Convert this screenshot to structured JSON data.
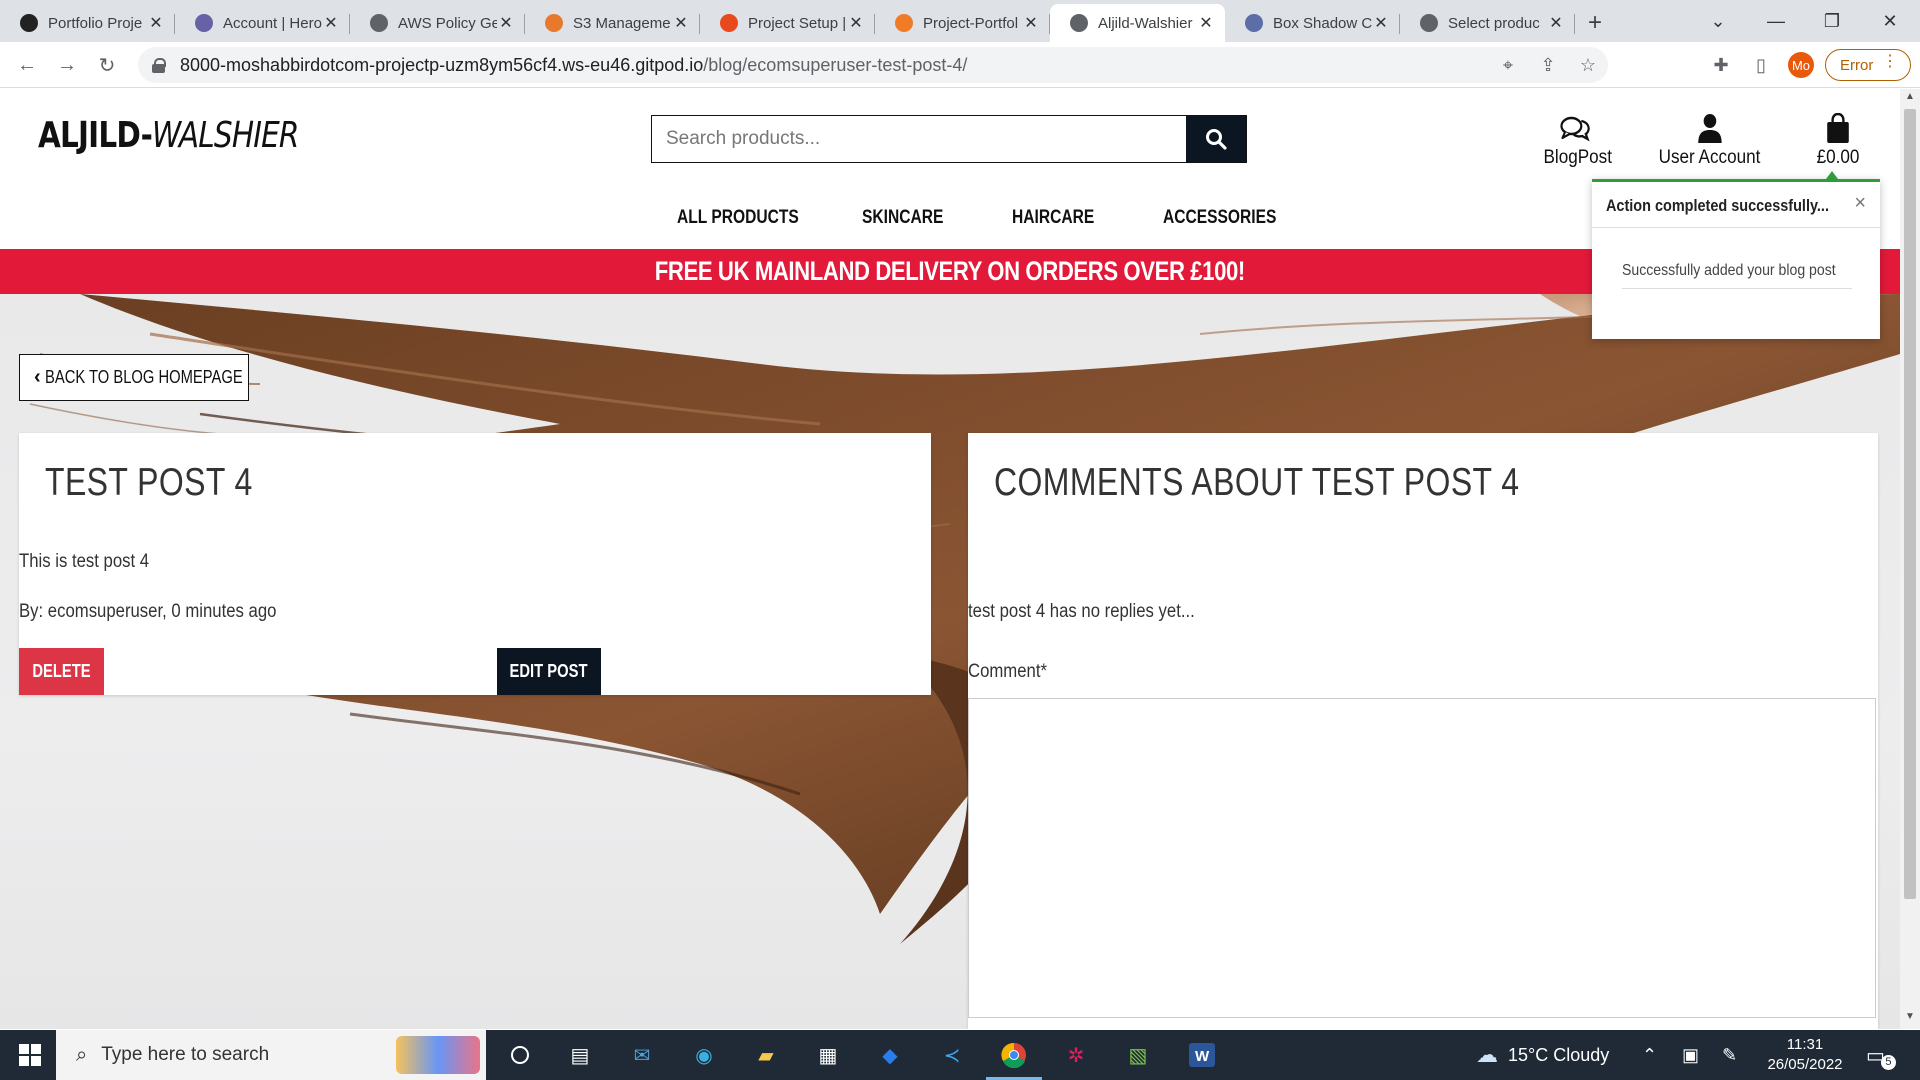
{
  "browser": {
    "tabs": [
      {
        "label": "Portfolio Proje",
        "icon": "github-icon",
        "color": "#222222"
      },
      {
        "label": "Account | Hero",
        "icon": "heroku-icon",
        "color": "#6762a6"
      },
      {
        "label": "AWS Policy Ge",
        "icon": "globe-icon",
        "color": "#5f6368"
      },
      {
        "label": "S3 Manageme",
        "icon": "aws-s3-icon",
        "color": "#e8792c"
      },
      {
        "label": "Project Setup |",
        "icon": "opera-icon",
        "color": "#e8491d"
      },
      {
        "label": "Project-Portfol",
        "icon": "g-icon",
        "color": "#f07c28"
      },
      {
        "label": "Aljild-Walshier",
        "icon": "globe-icon",
        "color": "#5f6368",
        "active": true
      },
      {
        "label": "Box Shadow C",
        "icon": "window-icon",
        "color": "#5b6ea8"
      },
      {
        "label": "Select produc",
        "icon": "globe-icon",
        "color": "#5f6368"
      }
    ],
    "url_host": "8000-moshabbirdotcom-projectp-uzm8ym56cf4.ws-eu46.gitpod.io",
    "url_path": "/blog/ecomsuperuser-test-post-4/",
    "profile_initials": "Mo",
    "error_label": "Error"
  },
  "site": {
    "logo_main": "ALJILD-",
    "logo_italic": "WALSHIER",
    "search_placeholder": "Search products...",
    "header": {
      "blog_label": "BlogPost",
      "account_label": "User Account",
      "bag_total": "£0.00"
    },
    "nav": [
      "ALL PRODUCTS",
      "SKINCARE",
      "HAIRCARE",
      "ACCESSORIES"
    ],
    "banner": "FREE UK MAINLAND DELIVERY ON ORDERS OVER £100!"
  },
  "toast": {
    "title": "Action completed successfully...",
    "message": "Successfully added your blog post",
    "accent": "#2e9e3c"
  },
  "post": {
    "back_label": "BACK TO BLOG HOMEPAGE",
    "title": "TEST POST 4",
    "body": "This is test post 4",
    "byline": "By: ecomsuperuser, 0 minutes ago",
    "delete_label": "DELETE",
    "edit_label": "EDIT POST"
  },
  "comments": {
    "title": "COMMENTS ABOUT TEST POST 4",
    "empty_text": "test post 4 has no replies yet...",
    "field_label": "Comment*"
  },
  "taskbar": {
    "search_placeholder": "Type here to search",
    "weather": "15°C  Cloudy",
    "time": "11:31",
    "date": "26/05/2022",
    "notifications": "5"
  }
}
